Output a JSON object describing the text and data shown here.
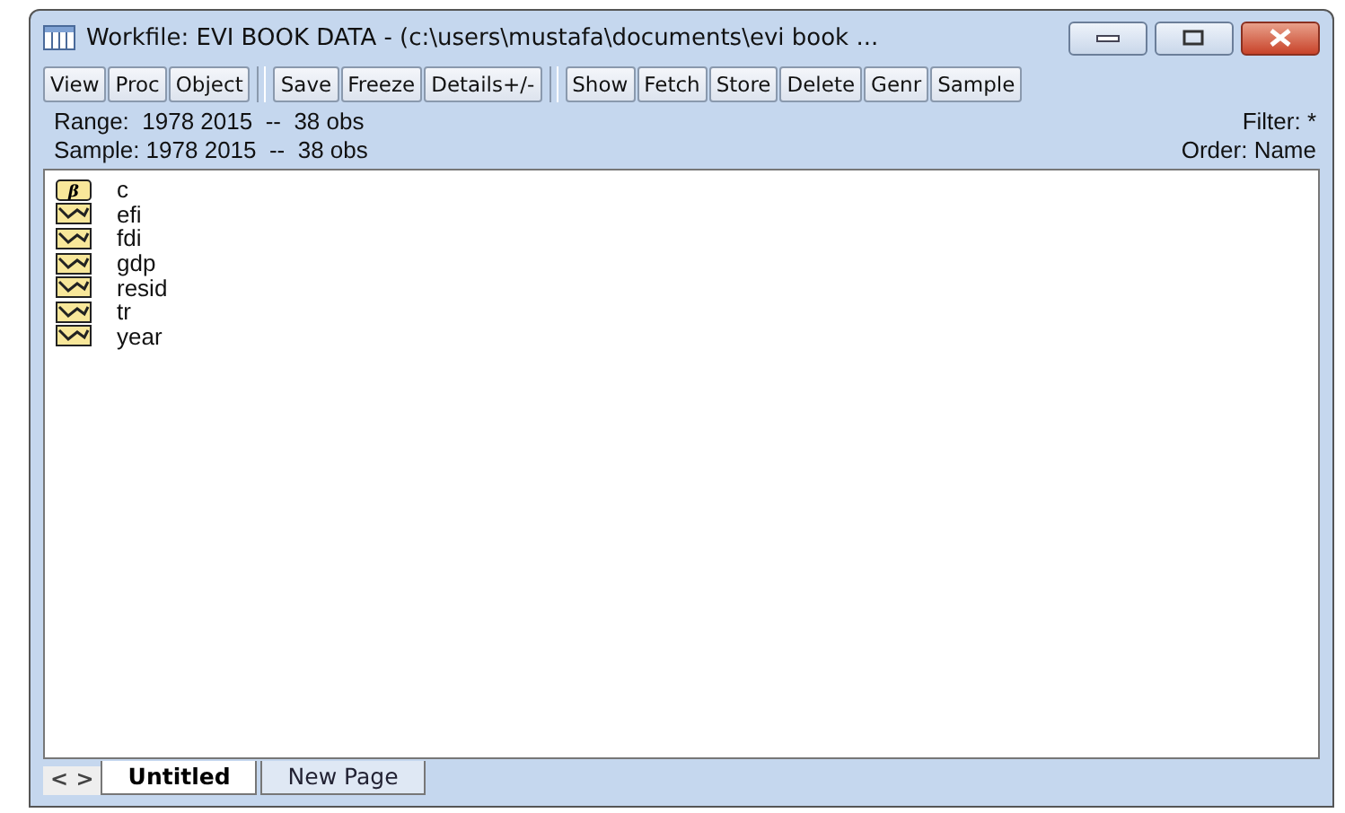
{
  "window": {
    "title": "Workfile: EVI BOOK DATA - (c:\\users\\mustafa\\documents\\evi book ..."
  },
  "toolbar": [
    "View",
    "Proc",
    "Object",
    "Save",
    "Freeze",
    "Details+/-",
    "Show",
    "Fetch",
    "Store",
    "Delete",
    "Genr",
    "Sample"
  ],
  "info": {
    "range": "Range:  1978 2015  --  38 obs",
    "sample": "Sample: 1978 2015  --  38 obs",
    "filter": "Filter: *",
    "order": "Order: Name"
  },
  "objects": [
    {
      "name": "c",
      "kind": "coef",
      "symbol": "β"
    },
    {
      "name": "efi",
      "kind": "series"
    },
    {
      "name": "fdi",
      "kind": "series"
    },
    {
      "name": "gdp",
      "kind": "series"
    },
    {
      "name": "resid",
      "kind": "series"
    },
    {
      "name": "tr",
      "kind": "series"
    },
    {
      "name": "year",
      "kind": "series"
    }
  ],
  "page_nav": "< >",
  "tabs": [
    {
      "label": "Untitled",
      "selected": true
    },
    {
      "label": "New Page",
      "selected": false
    }
  ]
}
